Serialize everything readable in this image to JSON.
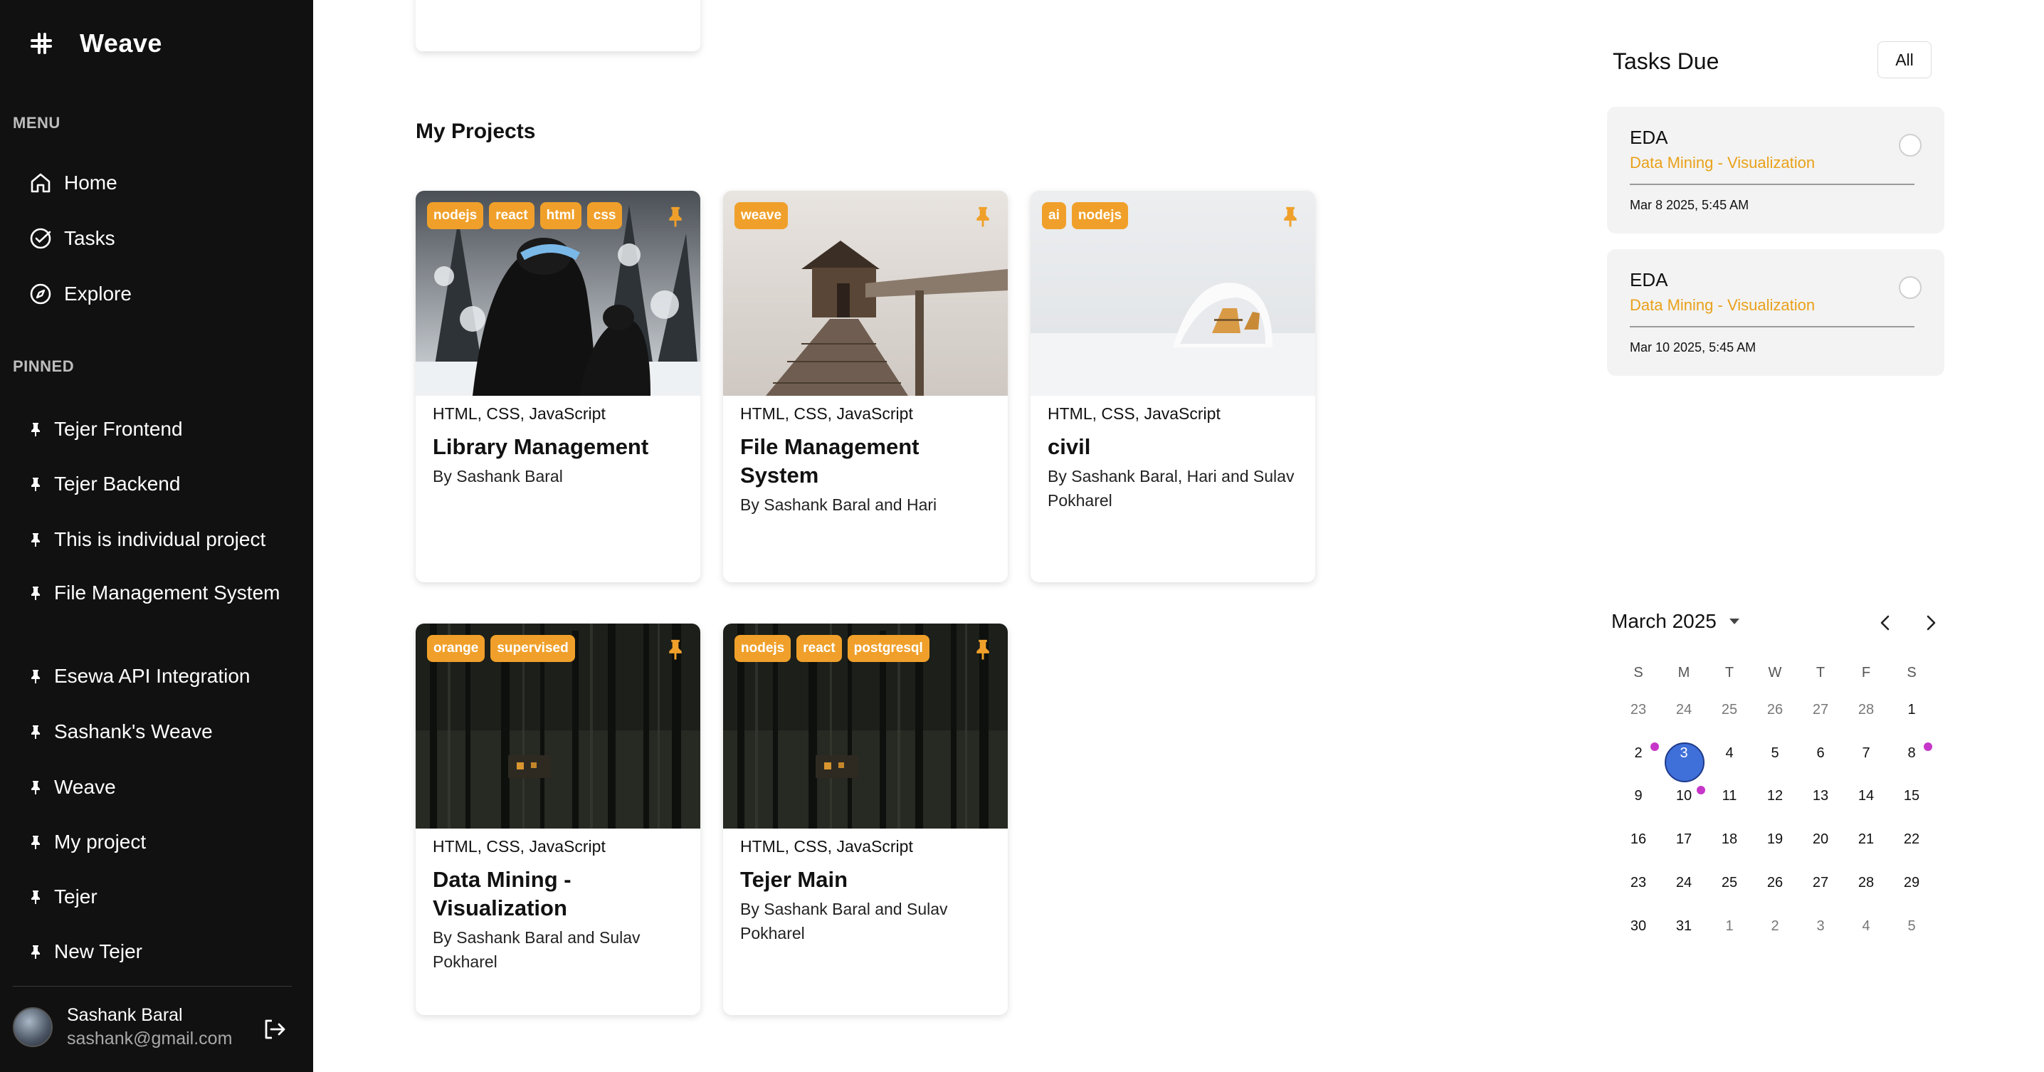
{
  "app": {
    "name": "Weave"
  },
  "sidebar": {
    "menu_title": "MENU",
    "menu": [
      {
        "label": "Home",
        "icon": "home-icon"
      },
      {
        "label": "Tasks",
        "icon": "check-circle-icon"
      },
      {
        "label": "Explore",
        "icon": "compass-icon"
      }
    ],
    "pinned_title": "PINNED",
    "pinned": [
      {
        "label": "Tejer Frontend"
      },
      {
        "label": "Tejer Backend"
      },
      {
        "label": "This is individual project"
      },
      {
        "label": "File Management System"
      },
      {
        "label": "Esewa API Integration"
      },
      {
        "label": "Sashank's Weave"
      },
      {
        "label": "Weave"
      },
      {
        "label": "My project"
      },
      {
        "label": "Tejer"
      },
      {
        "label": "New Tejer"
      }
    ],
    "user": {
      "name": "Sashank Baral",
      "email": "sashank@gmail.com"
    }
  },
  "projects": {
    "title": "My Projects",
    "cards": [
      {
        "tags": [
          "nodejs",
          "react",
          "html",
          "css"
        ],
        "tech": "HTML, CSS, JavaScript",
        "title": "Library Management",
        "by": "By Sashank Baral",
        "image": "snow-skiers"
      },
      {
        "tags": [
          "weave"
        ],
        "tech": "HTML, CSS, JavaScript",
        "title": "File Management System",
        "by": "By Sashank Baral and Hari",
        "image": "lake-boathouse"
      },
      {
        "tags": [
          "ai",
          "nodejs"
        ],
        "tech": "HTML, CSS, JavaScript",
        "title": "civil",
        "by": "By Sashank Baral, Hari and Sulav Pokharel",
        "image": "snow-cabin"
      },
      {
        "tags": [
          "orange",
          "supervised"
        ],
        "tech": "HTML, CSS, JavaScript",
        "title": "Data Mining - Visualization",
        "by": "By Sashank Baral and Sulav Pokharel",
        "image": "dark-forest"
      },
      {
        "tags": [
          "nodejs",
          "react",
          "postgresql"
        ],
        "tech": "HTML, CSS, JavaScript",
        "title": "Tejer Main",
        "by": "By Sashank Baral and Sulav Pokharel",
        "image": "dark-forest"
      }
    ]
  },
  "tasks": {
    "title": "Tasks Due",
    "filter_label": "All",
    "items": [
      {
        "name": "EDA",
        "project": "Data Mining - Visualization",
        "date": "Mar 8 2025, 5:45 AM"
      },
      {
        "name": "EDA",
        "project": "Data Mining - Visualization",
        "date": "Mar 10 2025, 5:45 AM"
      }
    ]
  },
  "calendar": {
    "month_label": "March 2025",
    "weekdays": [
      "S",
      "M",
      "T",
      "W",
      "T",
      "F",
      "S"
    ],
    "weeks": [
      [
        "23",
        "24",
        "25",
        "26",
        "27",
        "28",
        "1"
      ],
      [
        "2",
        "3",
        "4",
        "5",
        "6",
        "7",
        "8"
      ],
      [
        "9",
        "10",
        "11",
        "12",
        "13",
        "14",
        "15"
      ],
      [
        "16",
        "17",
        "18",
        "19",
        "20",
        "21",
        "22"
      ],
      [
        "23",
        "24",
        "25",
        "26",
        "27",
        "28",
        "29"
      ],
      [
        "30",
        "31",
        "1",
        "2",
        "3",
        "4",
        "5"
      ]
    ],
    "selected_day": "3",
    "accent": "#3f6fd9",
    "event_dot_color": "#c636c8"
  },
  "colors": {
    "sidebar_bg": "#111111",
    "tag_bg": "#f0a02a",
    "task_project": "#e9a11a"
  }
}
